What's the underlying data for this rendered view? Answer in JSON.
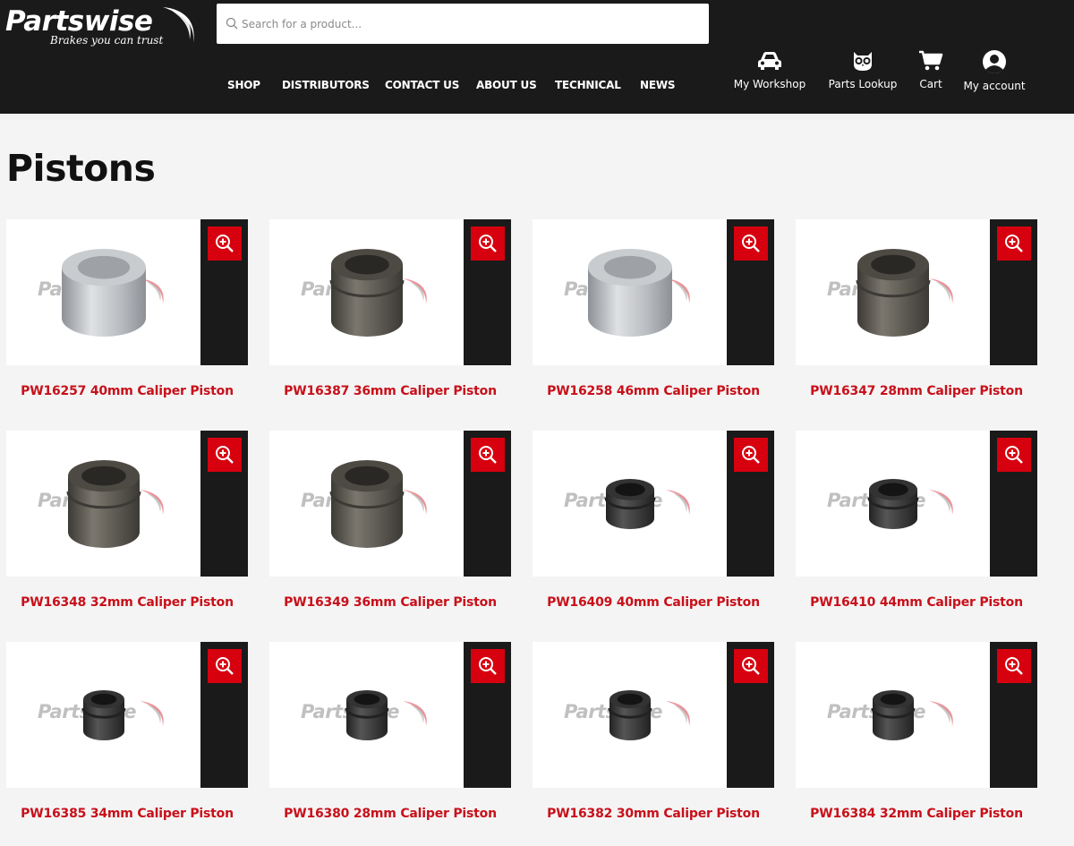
{
  "brand": {
    "name": "Partswise",
    "tagline": "Brakes you can trust"
  },
  "search": {
    "placeholder": "Search for a product..."
  },
  "nav": [
    {
      "label": "SHOP"
    },
    {
      "label": "DISTRIBUTORS"
    },
    {
      "label": "CONTACT US"
    },
    {
      "label": "ABOUT US"
    },
    {
      "label": "TECHNICAL"
    },
    {
      "label": "NEWS"
    }
  ],
  "utility": [
    {
      "label": "My Workshop",
      "icon": "car-icon"
    },
    {
      "label": "Parts Lookup",
      "icon": "owl-icon"
    },
    {
      "label": "Cart",
      "icon": "cart-icon"
    },
    {
      "label": "My account",
      "icon": "user-icon"
    }
  ],
  "page": {
    "title": "Pistons"
  },
  "products": [
    {
      "title": "PW16257 40mm Caliper Piston",
      "finish": "silver"
    },
    {
      "title": "PW16387 36mm Caliper Piston",
      "finish": "dark"
    },
    {
      "title": "PW16258 46mm Caliper Piston",
      "finish": "silver"
    },
    {
      "title": "PW16347 28mm Caliper Piston",
      "finish": "dark"
    },
    {
      "title": "PW16348 32mm Caliper Piston",
      "finish": "dark"
    },
    {
      "title": "PW16349 36mm Caliper Piston",
      "finish": "dark"
    },
    {
      "title": "PW16409 40mm Caliper Piston",
      "finish": "black"
    },
    {
      "title": "PW16410 44mm Caliper Piston",
      "finish": "black"
    },
    {
      "title": "PW16385 34mm Caliper Piston",
      "finish": "black"
    },
    {
      "title": "PW16380 28mm Caliper Piston",
      "finish": "black"
    },
    {
      "title": "PW16382 30mm Caliper Piston",
      "finish": "black"
    },
    {
      "title": "PW16384 32mm Caliper Piston",
      "finish": "black"
    }
  ],
  "colors": {
    "header_bg": "#1a1a1a",
    "accent_red": "#d7000f",
    "title_red": "#c8101a",
    "page_bg": "#f4f4f4"
  }
}
